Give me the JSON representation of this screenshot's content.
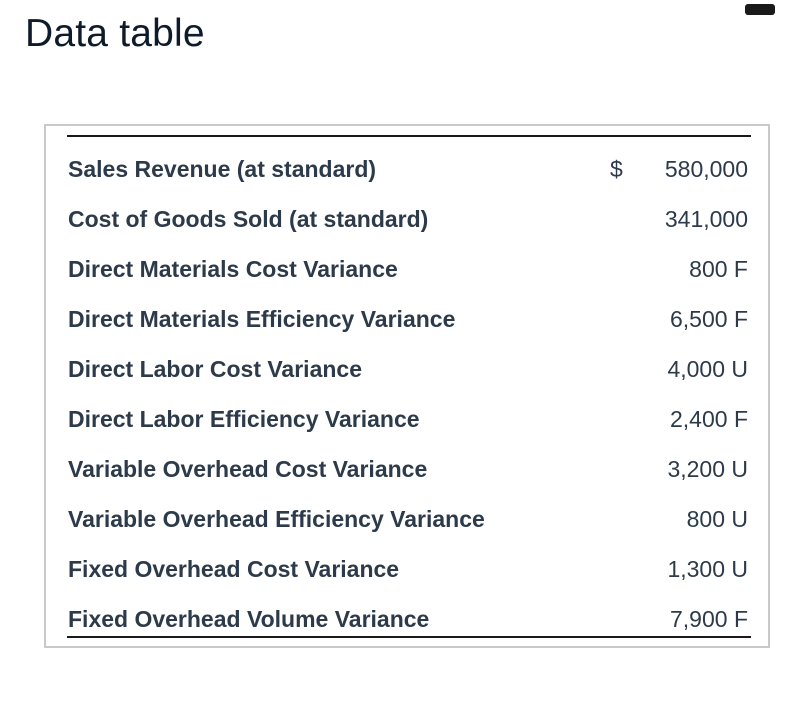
{
  "window": {
    "title": "Data table"
  },
  "table": {
    "rows": [
      {
        "label": "Sales Revenue (at standard)",
        "currency": "$",
        "value": "580,000"
      },
      {
        "label": "Cost of Goods Sold (at standard)",
        "currency": "",
        "value": "341,000"
      },
      {
        "label": "Direct Materials Cost Variance",
        "currency": "",
        "value": "800 F"
      },
      {
        "label": "Direct Materials Efficiency Variance",
        "currency": "",
        "value": "6,500 F"
      },
      {
        "label": "Direct Labor Cost Variance",
        "currency": "",
        "value": "4,000 U"
      },
      {
        "label": "Direct Labor Efficiency Variance",
        "currency": "",
        "value": "2,400 F"
      },
      {
        "label": "Variable Overhead Cost Variance",
        "currency": "",
        "value": "3,200 U"
      },
      {
        "label": "Variable Overhead Efficiency Variance",
        "currency": "",
        "value": "800 U"
      },
      {
        "label": "Fixed Overhead Cost Variance",
        "currency": "",
        "value": "1,300 U"
      },
      {
        "label": "Fixed Overhead Volume Variance",
        "currency": "",
        "value": "7,900 F"
      }
    ]
  }
}
